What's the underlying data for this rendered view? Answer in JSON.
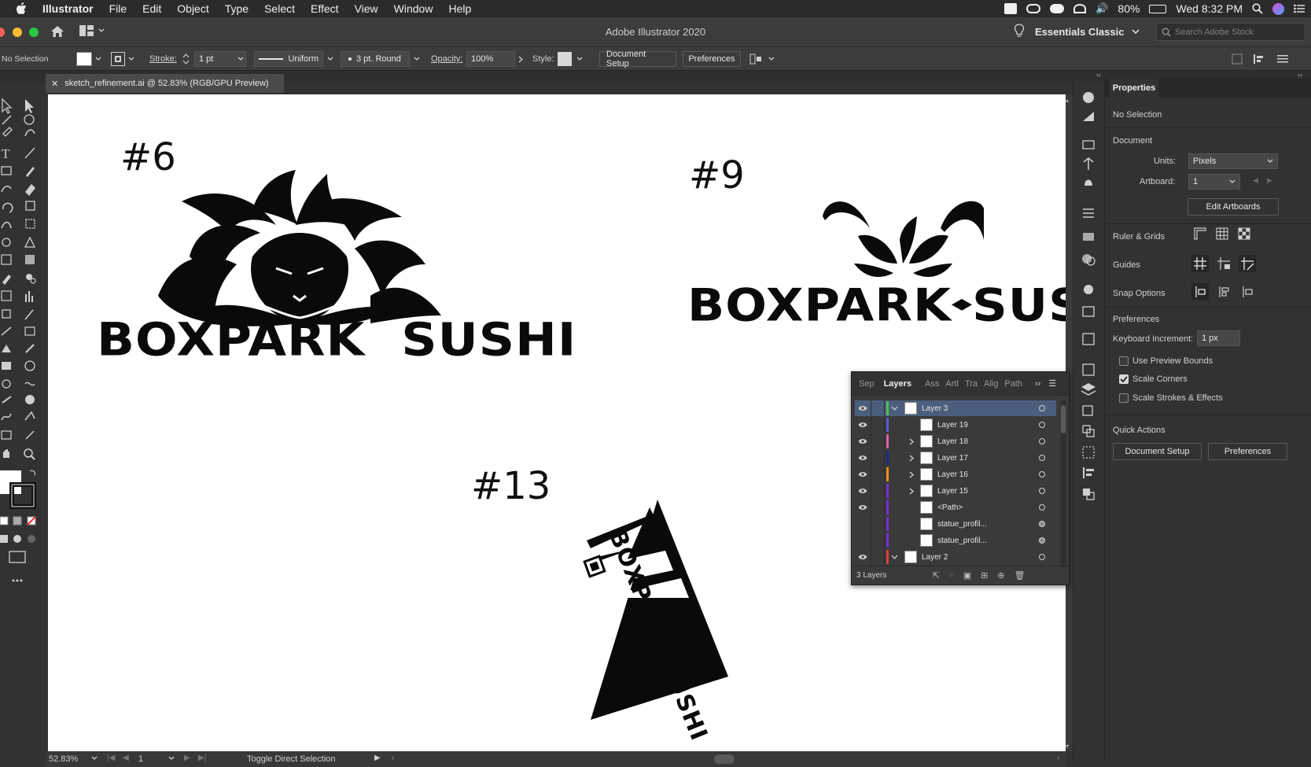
{
  "menubar": {
    "app": "Illustrator",
    "items": [
      "File",
      "Edit",
      "Object",
      "Type",
      "Select",
      "Effect",
      "View",
      "Window",
      "Help"
    ],
    "battery": "80%",
    "clock": "Wed 8:32 PM"
  },
  "titlebar": {
    "title": "Adobe Illustrator 2020",
    "workspace": "Essentials Classic",
    "search_placeholder": "Search Adobe Stock"
  },
  "controlbar": {
    "selection": "No Selection",
    "stroke_label": "Stroke:",
    "stroke_value": "1 pt",
    "profile": "Uniform",
    "brush": "3 pt. Round",
    "opacity_label": "Opacity:",
    "opacity_value": "100%",
    "style_label": "Style:",
    "document_setup": "Document Setup",
    "preferences": "Preferences"
  },
  "document": {
    "tab_title": "sketch_refinement.ai @ 52.83% (RGB/GPU Preview)",
    "labels": [
      "#6",
      "#9",
      "#13"
    ],
    "logo_text_6": "BOXPARK  SUSHI",
    "logo_text_9a": "BOXPARK",
    "logo_text_9b": "SUSHI",
    "logo_text_13": "BOXPARK SUSHI"
  },
  "layers_panel": {
    "tabs": [
      "Sep",
      "Layers",
      "Ass",
      "Artl",
      "Tra",
      "Alig",
      "Path"
    ],
    "active_tab": "Layers",
    "rows": [
      {
        "name": "Layer 3",
        "color": "#4fc34f",
        "level": 0,
        "expanded": true,
        "visible": true,
        "selected": true
      },
      {
        "name": "Layer 19",
        "color": "#5b5bd8",
        "level": 1,
        "expanded": false,
        "visible": true
      },
      {
        "name": "Layer 18",
        "color": "#e060a8",
        "level": 1,
        "expanded": false,
        "visible": true,
        "has_children": true
      },
      {
        "name": "Layer 17",
        "color": "#1e2a8a",
        "level": 1,
        "expanded": false,
        "visible": true,
        "has_children": true
      },
      {
        "name": "Layer 16",
        "color": "#f08a1c",
        "level": 1,
        "expanded": false,
        "visible": true,
        "has_children": true
      },
      {
        "name": "Layer 15",
        "color": "#7b2bd8",
        "level": 1,
        "expanded": false,
        "visible": true,
        "has_children": true
      },
      {
        "name": "<Path>",
        "color": "#7b2bd8",
        "level": 1,
        "expanded": false,
        "visible": true
      },
      {
        "name": "statue_profil...",
        "color": "#7b2bd8",
        "level": 1,
        "expanded": false,
        "visible": false
      },
      {
        "name": "statue_profil...",
        "color": "#7b2bd8",
        "level": 1,
        "expanded": false,
        "visible": false
      },
      {
        "name": "Layer 2",
        "color": "#e04040",
        "level": 0,
        "expanded": true,
        "visible": true
      }
    ],
    "footer": "3 Layers"
  },
  "properties": {
    "tab": "Properties",
    "selection": "No Selection",
    "document_heading": "Document",
    "units_label": "Units:",
    "units_value": "Pixels",
    "artboard_label": "Artboard:",
    "artboard_value": "1",
    "edit_artboards": "Edit Artboards",
    "ruler_grids": "Ruler & Grids",
    "guides": "Guides",
    "snap_options": "Snap Options",
    "preferences_heading": "Preferences",
    "keyboard_increment_label": "Keyboard Increment:",
    "keyboard_increment_value": "1 px",
    "use_preview_bounds": "Use Preview Bounds",
    "scale_corners": "Scale Corners",
    "scale_strokes": "Scale Strokes & Effects",
    "use_preview_bounds_checked": false,
    "scale_corners_checked": true,
    "scale_strokes_checked": false,
    "quick_actions": "Quick Actions",
    "qa_document_setup": "Document Setup",
    "qa_preferences": "Preferences"
  },
  "statusbar": {
    "zoom": "52.83%",
    "artboard": "1",
    "status": "Toggle Direct Selection"
  }
}
